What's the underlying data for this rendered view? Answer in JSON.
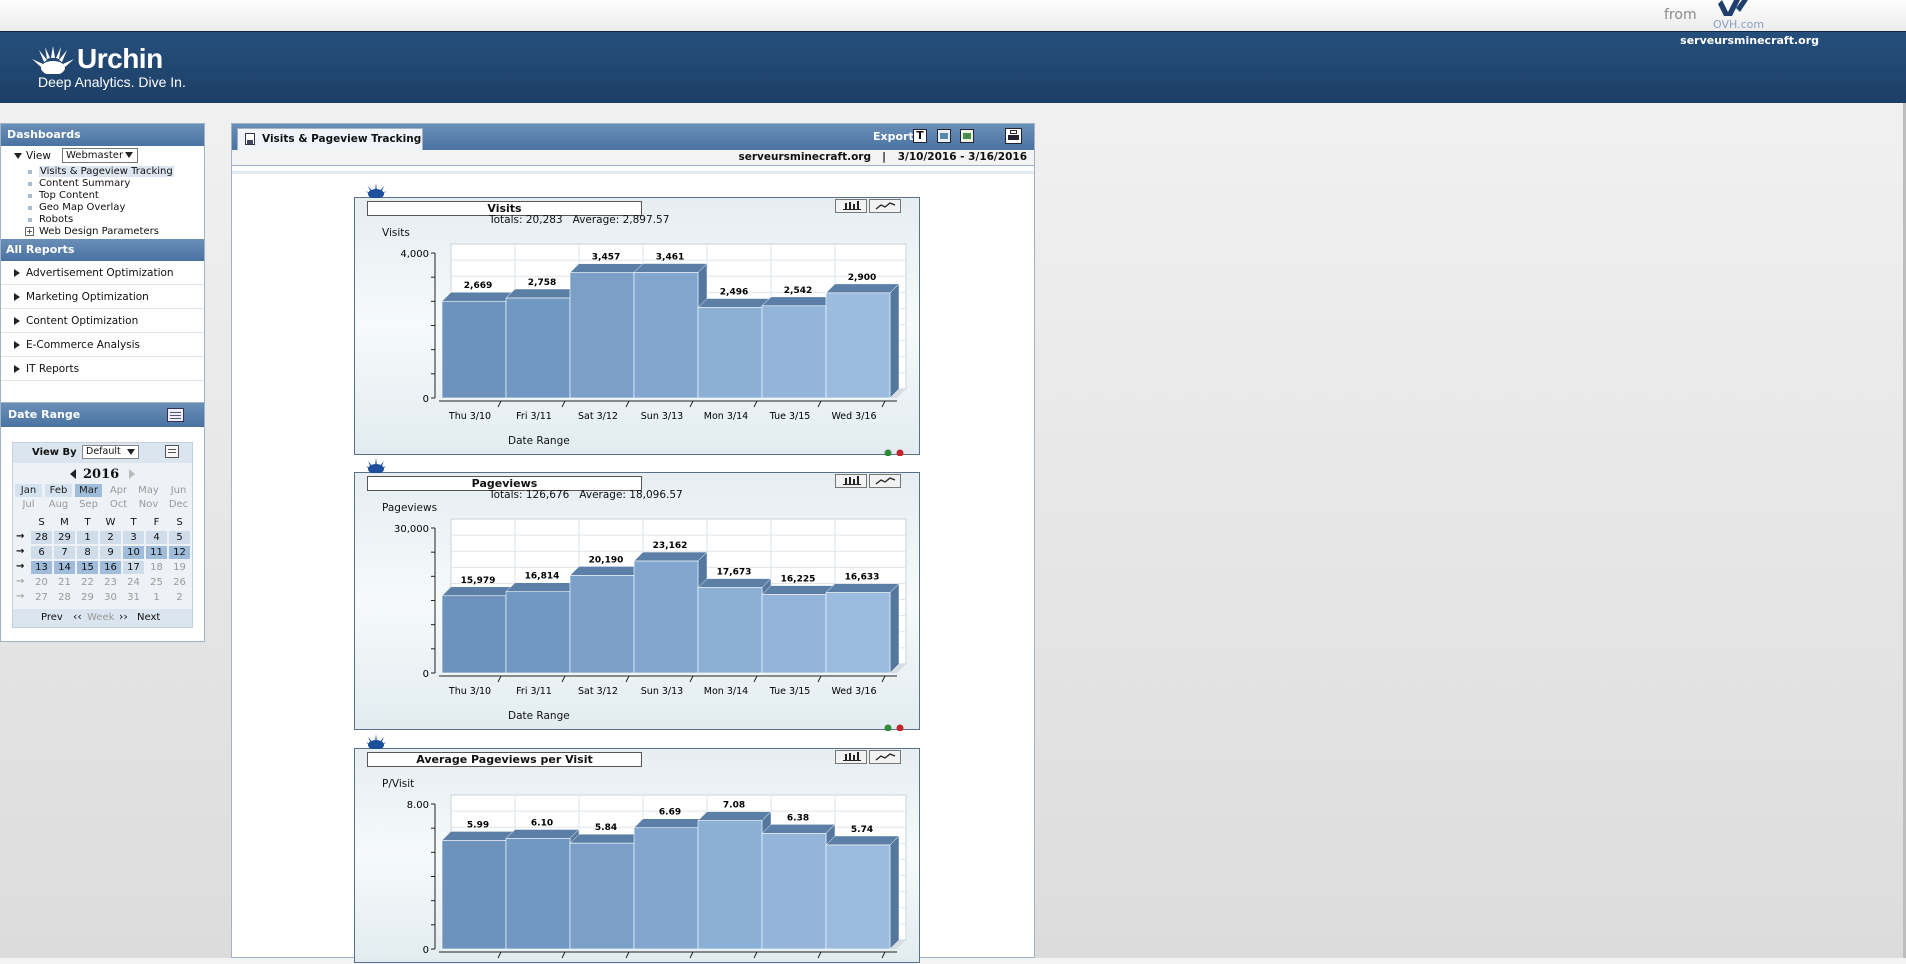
{
  "top": {
    "from": "from",
    "ovh": "OVH.com"
  },
  "header": {
    "brand": "Urchin",
    "tagline": "Deep Analytics. Dive In.",
    "site": "serveursminecraft.org"
  },
  "sidebar": {
    "dashboards_title": "Dashboards",
    "view_label": "View",
    "view_value": "Webmaster",
    "items": [
      "Visits & Pageview Tracking",
      "Content Summary",
      "Top Content",
      "Geo Map Overlay",
      "Robots",
      "Web Design Parameters"
    ],
    "all_reports_title": "All Reports",
    "reports": [
      "Advertisement Optimization",
      "Marketing Optimization",
      "Content Optimization",
      "E-Commerce Analysis",
      "IT Reports"
    ]
  },
  "date_range": {
    "title": "Date Range",
    "view_by_label": "View By",
    "view_by_value": "Default",
    "year": "2016",
    "months": [
      "Jan",
      "Feb",
      "Mar",
      "Apr",
      "May",
      "Jun",
      "Jul",
      "Aug",
      "Sep",
      "Oct",
      "Nov",
      "Dec"
    ],
    "weekdays": [
      "S",
      "M",
      "T",
      "W",
      "T",
      "F",
      "S"
    ],
    "weeks": [
      [
        "28",
        "29",
        "1",
        "2",
        "3",
        "4",
        "5"
      ],
      [
        "6",
        "7",
        "8",
        "9",
        "10",
        "11",
        "12"
      ],
      [
        "13",
        "14",
        "15",
        "16",
        "17",
        "18",
        "19"
      ],
      [
        "20",
        "21",
        "22",
        "23",
        "24",
        "25",
        "26"
      ],
      [
        "27",
        "28",
        "29",
        "30",
        "31",
        "1",
        "2"
      ]
    ],
    "prev": "Prev",
    "week": "Week",
    "next": "Next"
  },
  "main": {
    "tab_title": "Visits & Pageview Tracking",
    "export_label": "Export",
    "site": "serveursminecraft.org",
    "range": "3/10/2016 - 3/16/2016",
    "sep": "|"
  },
  "colors": {
    "header": "#1f4470",
    "panel_head": "#5a80ad",
    "bar_front": "#6f98c4",
    "bar_top": "#5a7ea6",
    "bar_side": "#4f7199"
  },
  "chart_data": [
    {
      "type": "bar",
      "title": "Visits",
      "totals_text": "Totals: 20,283   Average: 2,897.57",
      "ylabel": "Visits",
      "xlabel": "Date Range",
      "categories": [
        "Thu 3/10",
        "Fri 3/11",
        "Sat 3/12",
        "Sun 3/13",
        "Mon 3/14",
        "Tue 3/15",
        "Wed 3/16"
      ],
      "values": [
        2669,
        2758,
        3457,
        3461,
        2496,
        2542,
        2900
      ],
      "value_labels": [
        "2,669",
        "2,758",
        "3,457",
        "3,461",
        "2,496",
        "2,542",
        "2,900"
      ],
      "ylim": [
        0,
        4000
      ],
      "ytick_labels": [
        "0",
        "4,000"
      ]
    },
    {
      "type": "bar",
      "title": "Pageviews",
      "totals_text": "Totals: 126,676   Average: 18,096.57",
      "ylabel": "Pageviews",
      "xlabel": "Date Range",
      "categories": [
        "Thu 3/10",
        "Fri 3/11",
        "Sat 3/12",
        "Sun 3/13",
        "Mon 3/14",
        "Tue 3/15",
        "Wed 3/16"
      ],
      "values": [
        15979,
        16814,
        20190,
        23162,
        17673,
        16225,
        16633
      ],
      "value_labels": [
        "15,979",
        "16,814",
        "20,190",
        "23,162",
        "17,673",
        "16,225",
        "16,633"
      ],
      "ylim": [
        0,
        30000
      ],
      "ytick_labels": [
        "0",
        "30,000"
      ]
    },
    {
      "type": "bar",
      "title": "Average Pageviews per Visit",
      "totals_text": "",
      "ylabel": "P/Visit",
      "xlabel": "",
      "categories": [
        "",
        "",
        "",
        "",
        "",
        "",
        ""
      ],
      "values": [
        5.99,
        6.1,
        5.84,
        6.69,
        7.08,
        6.38,
        5.74
      ],
      "value_labels": [
        "5.99",
        "6.10",
        "5.84",
        "6.69",
        "7.08",
        "6.38",
        "5.74"
      ],
      "ylim": [
        0,
        8
      ],
      "ytick_labels": [
        "0",
        "8.00"
      ]
    }
  ]
}
